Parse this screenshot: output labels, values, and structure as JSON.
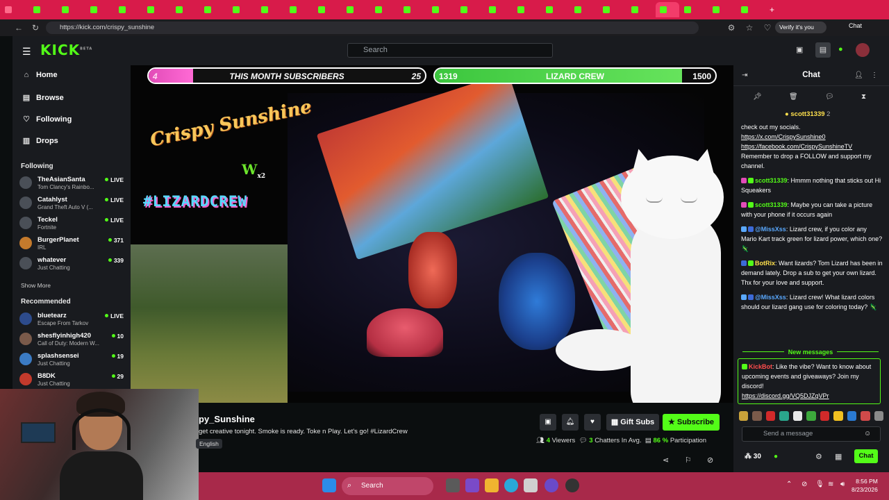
{
  "browser": {
    "url": "https://kick.com/crispy_sunshine",
    "verify_label": "Verify it's you",
    "chat_label": "Chat"
  },
  "header": {
    "logo": "KICK",
    "logo_tag": "BETA",
    "search_placeholder": "Search"
  },
  "sidebar": {
    "nav": [
      {
        "label": "Home",
        "icon": "home-icon"
      },
      {
        "label": "Browse",
        "icon": "browse-icon"
      },
      {
        "label": "Following",
        "icon": "heart-icon"
      },
      {
        "label": "Drops",
        "icon": "drops-icon"
      }
    ],
    "following_title": "Following",
    "following": [
      {
        "name": "TheAsianSanta",
        "game": "Tom Clancy's Rainbo...",
        "status": "LIVE"
      },
      {
        "name": "Catahlyst",
        "game": "Grand Theft Auto V (...",
        "status": "LIVE"
      },
      {
        "name": "Teckel",
        "game": "Fortnite",
        "status": "LIVE"
      },
      {
        "name": "BurgerPlanet",
        "game": "IRL",
        "status": "371"
      },
      {
        "name": "whatever",
        "game": "Just Chatting",
        "status": "339"
      }
    ],
    "show_more": "Show More",
    "recommended_title": "Recommended",
    "recommended": [
      {
        "name": "bluetearz",
        "game": "Escape From Tarkov",
        "status": "LIVE"
      },
      {
        "name": "shesflyinhigh420",
        "game": "Call of Duty: Modern W...",
        "status": "10"
      },
      {
        "name": "splashsensei",
        "game": "Just Chatting",
        "status": "19"
      },
      {
        "name": "B8DK",
        "game": "Just Chatting",
        "status": "29"
      }
    ]
  },
  "stream": {
    "goal1": {
      "label": "THIS MONTH SUBSCRIBERS",
      "current": "4",
      "target": "25",
      "progress": 0.16
    },
    "goal2": {
      "label": "LIZARD CREW",
      "current": "1319",
      "target": "1500",
      "progress": 0.88
    },
    "overlay_brand": "Crispy Sunshine",
    "overlay_tag": "#LIZARDCREW",
    "overlay_badge": "W",
    "overlay_badge_sub": "x2",
    "channel_name": "py_Sunshine",
    "title": "get creative tonight. Smoke is ready. Toke n Play. Let's go! #LizardCrew",
    "language": "English",
    "gift_subs": "Gift Subs",
    "subscribe": "Subscribe",
    "viewers": "4",
    "viewers_label": "Viewers",
    "chatters": "3",
    "chatters_label": "Chatters In Avg.",
    "participation": "86 %",
    "participation_label": "Participation"
  },
  "chat": {
    "title": "Chat",
    "pinned_user": "scott31339",
    "pinned_count": "2",
    "messages": [
      {
        "user": "",
        "color": "#ffffff",
        "text": "check out my socials."
      },
      {
        "user": "",
        "color": "#ffffff",
        "link": "https://x.com/CrispySunshine0"
      },
      {
        "user": "",
        "color": "#ffffff",
        "link": "https://facebook.com/CrispySunshineTV"
      },
      {
        "user": "",
        "color": "#ffffff",
        "text": "Remember to drop a FOLLOW and support my channel."
      },
      {
        "user": "scott31339",
        "color": "#53fc18",
        "text": "Hmmm nothing that sticks out Hi Squeakers"
      },
      {
        "user": "scott31339",
        "color": "#53fc18",
        "text": "Maybe you can take a picture with your phone if it occurs again"
      },
      {
        "user": "@MissXss",
        "color": "#5aa9ff",
        "text": "Lizard crew, if you color any Mario Kart track green for lizard power, which one? 🦎"
      },
      {
        "user": "BotRix",
        "color": "#ffe14d",
        "text": "Want lizards? Tom Lizard has been in demand lately. Drop a sub to get your own lizard. Thx for your love and support."
      },
      {
        "user": "@MissXss",
        "color": "#5aa9ff",
        "text": "Lizard crew! What lizard colors should our lizard gang use for coloring today? 🦎"
      }
    ],
    "new_messages": "New messages",
    "last_message": {
      "user": "KickBot",
      "color": "#ff4d4d",
      "text": "Like the vibe? Want to know about upcoming events and giveaways? Join my discord!",
      "link": "https://discord.gg/VQ5DJZqVPr"
    },
    "input_placeholder": "Send a message",
    "points": "30",
    "send_label": "Chat"
  },
  "taskbar": {
    "search": "Search",
    "time": "8:56 PM",
    "date": "8/23/2026"
  },
  "colors": {
    "accent": "#53fc18",
    "tabbar": "#d81b4a",
    "taskbar": "#a8294a"
  }
}
